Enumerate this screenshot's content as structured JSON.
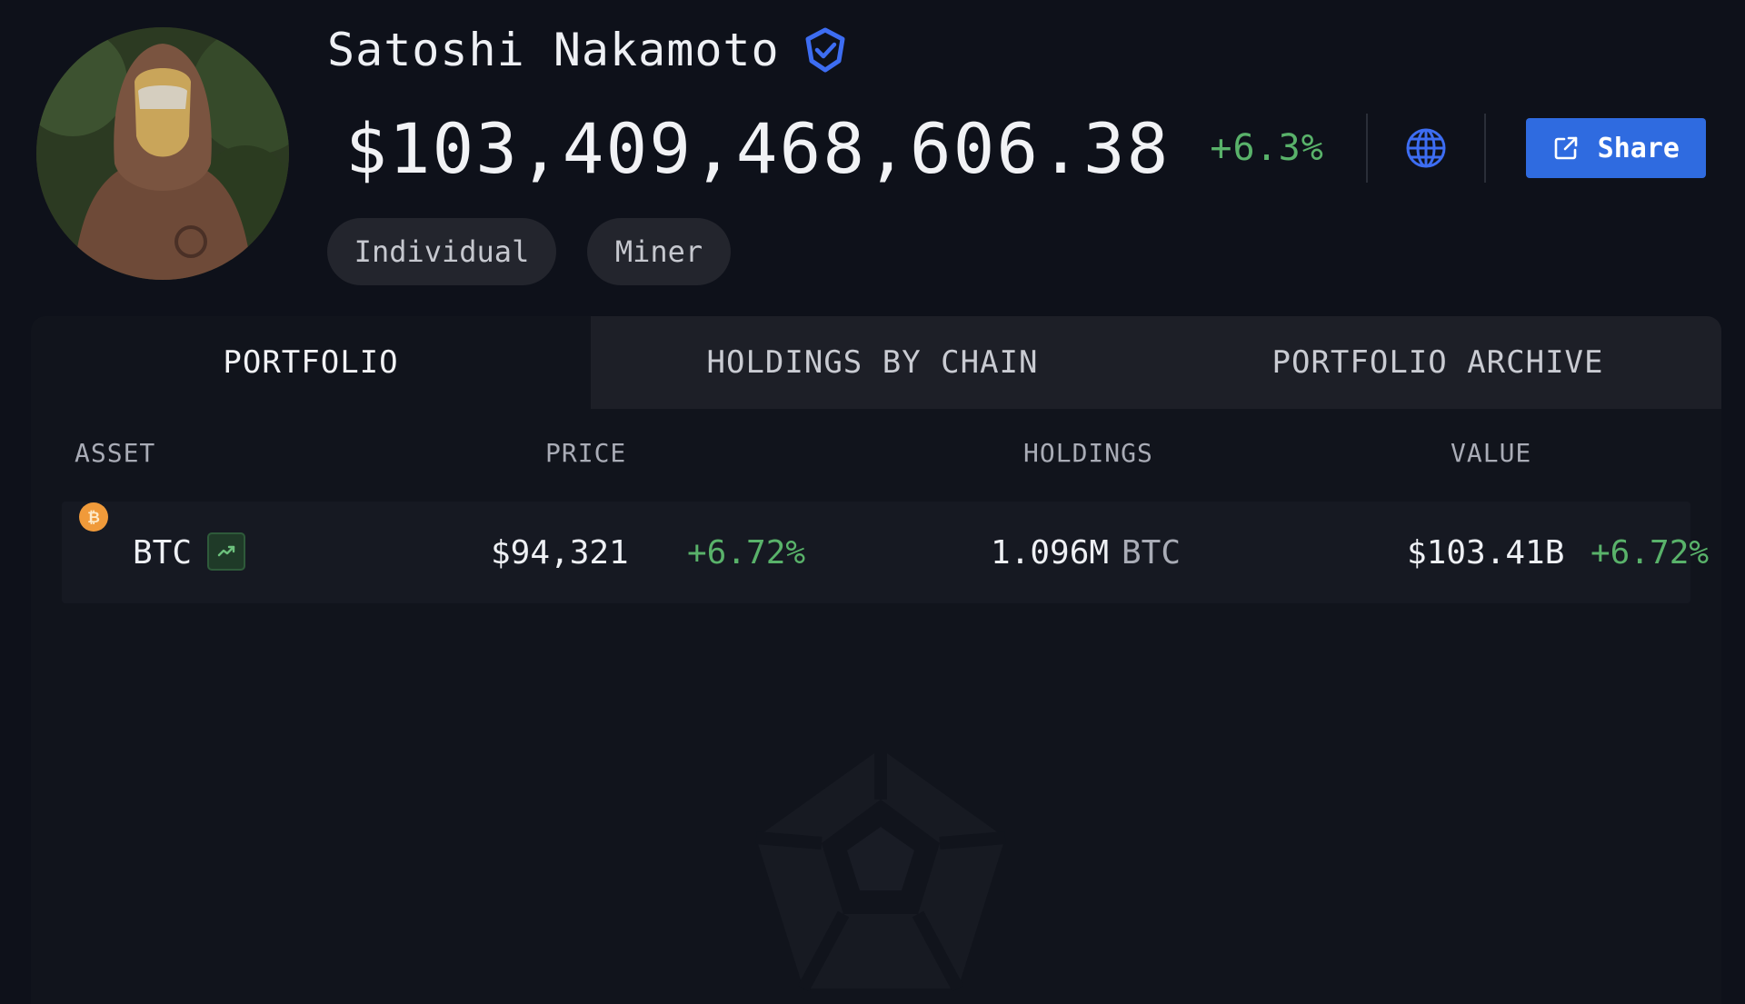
{
  "entity": {
    "name": "Satoshi Nakamoto",
    "balance": "$103,409,468,606.38",
    "balance_change": "+6.3%",
    "tags": [
      "Individual",
      "Miner"
    ]
  },
  "actions": {
    "share_label": "Share"
  },
  "tabs": [
    {
      "label": "PORTFOLIO",
      "active": true
    },
    {
      "label": "HOLDINGS BY CHAIN",
      "active": false
    },
    {
      "label": "PORTFOLIO ARCHIVE",
      "active": false
    }
  ],
  "table": {
    "columns": [
      "ASSET",
      "PRICE",
      "HOLDINGS",
      "VALUE"
    ],
    "rows": [
      {
        "asset": "BTC",
        "price": "$94,321",
        "price_change": "+6.72%",
        "holdings": "1.096M",
        "holdings_unit": "BTC",
        "value": "$103.41B",
        "value_change": "+6.72%"
      }
    ]
  },
  "icons": {
    "verified": "verified-badge-icon",
    "globe": "globe-icon",
    "share": "external-link-icon",
    "btc": "bitcoin-icon",
    "trend": "trending-up-icon",
    "watermark": "arkham-logo-icon"
  },
  "colors": {
    "background": "#0e111a",
    "accent": "#2f6be0",
    "positive": "#59b26a"
  }
}
